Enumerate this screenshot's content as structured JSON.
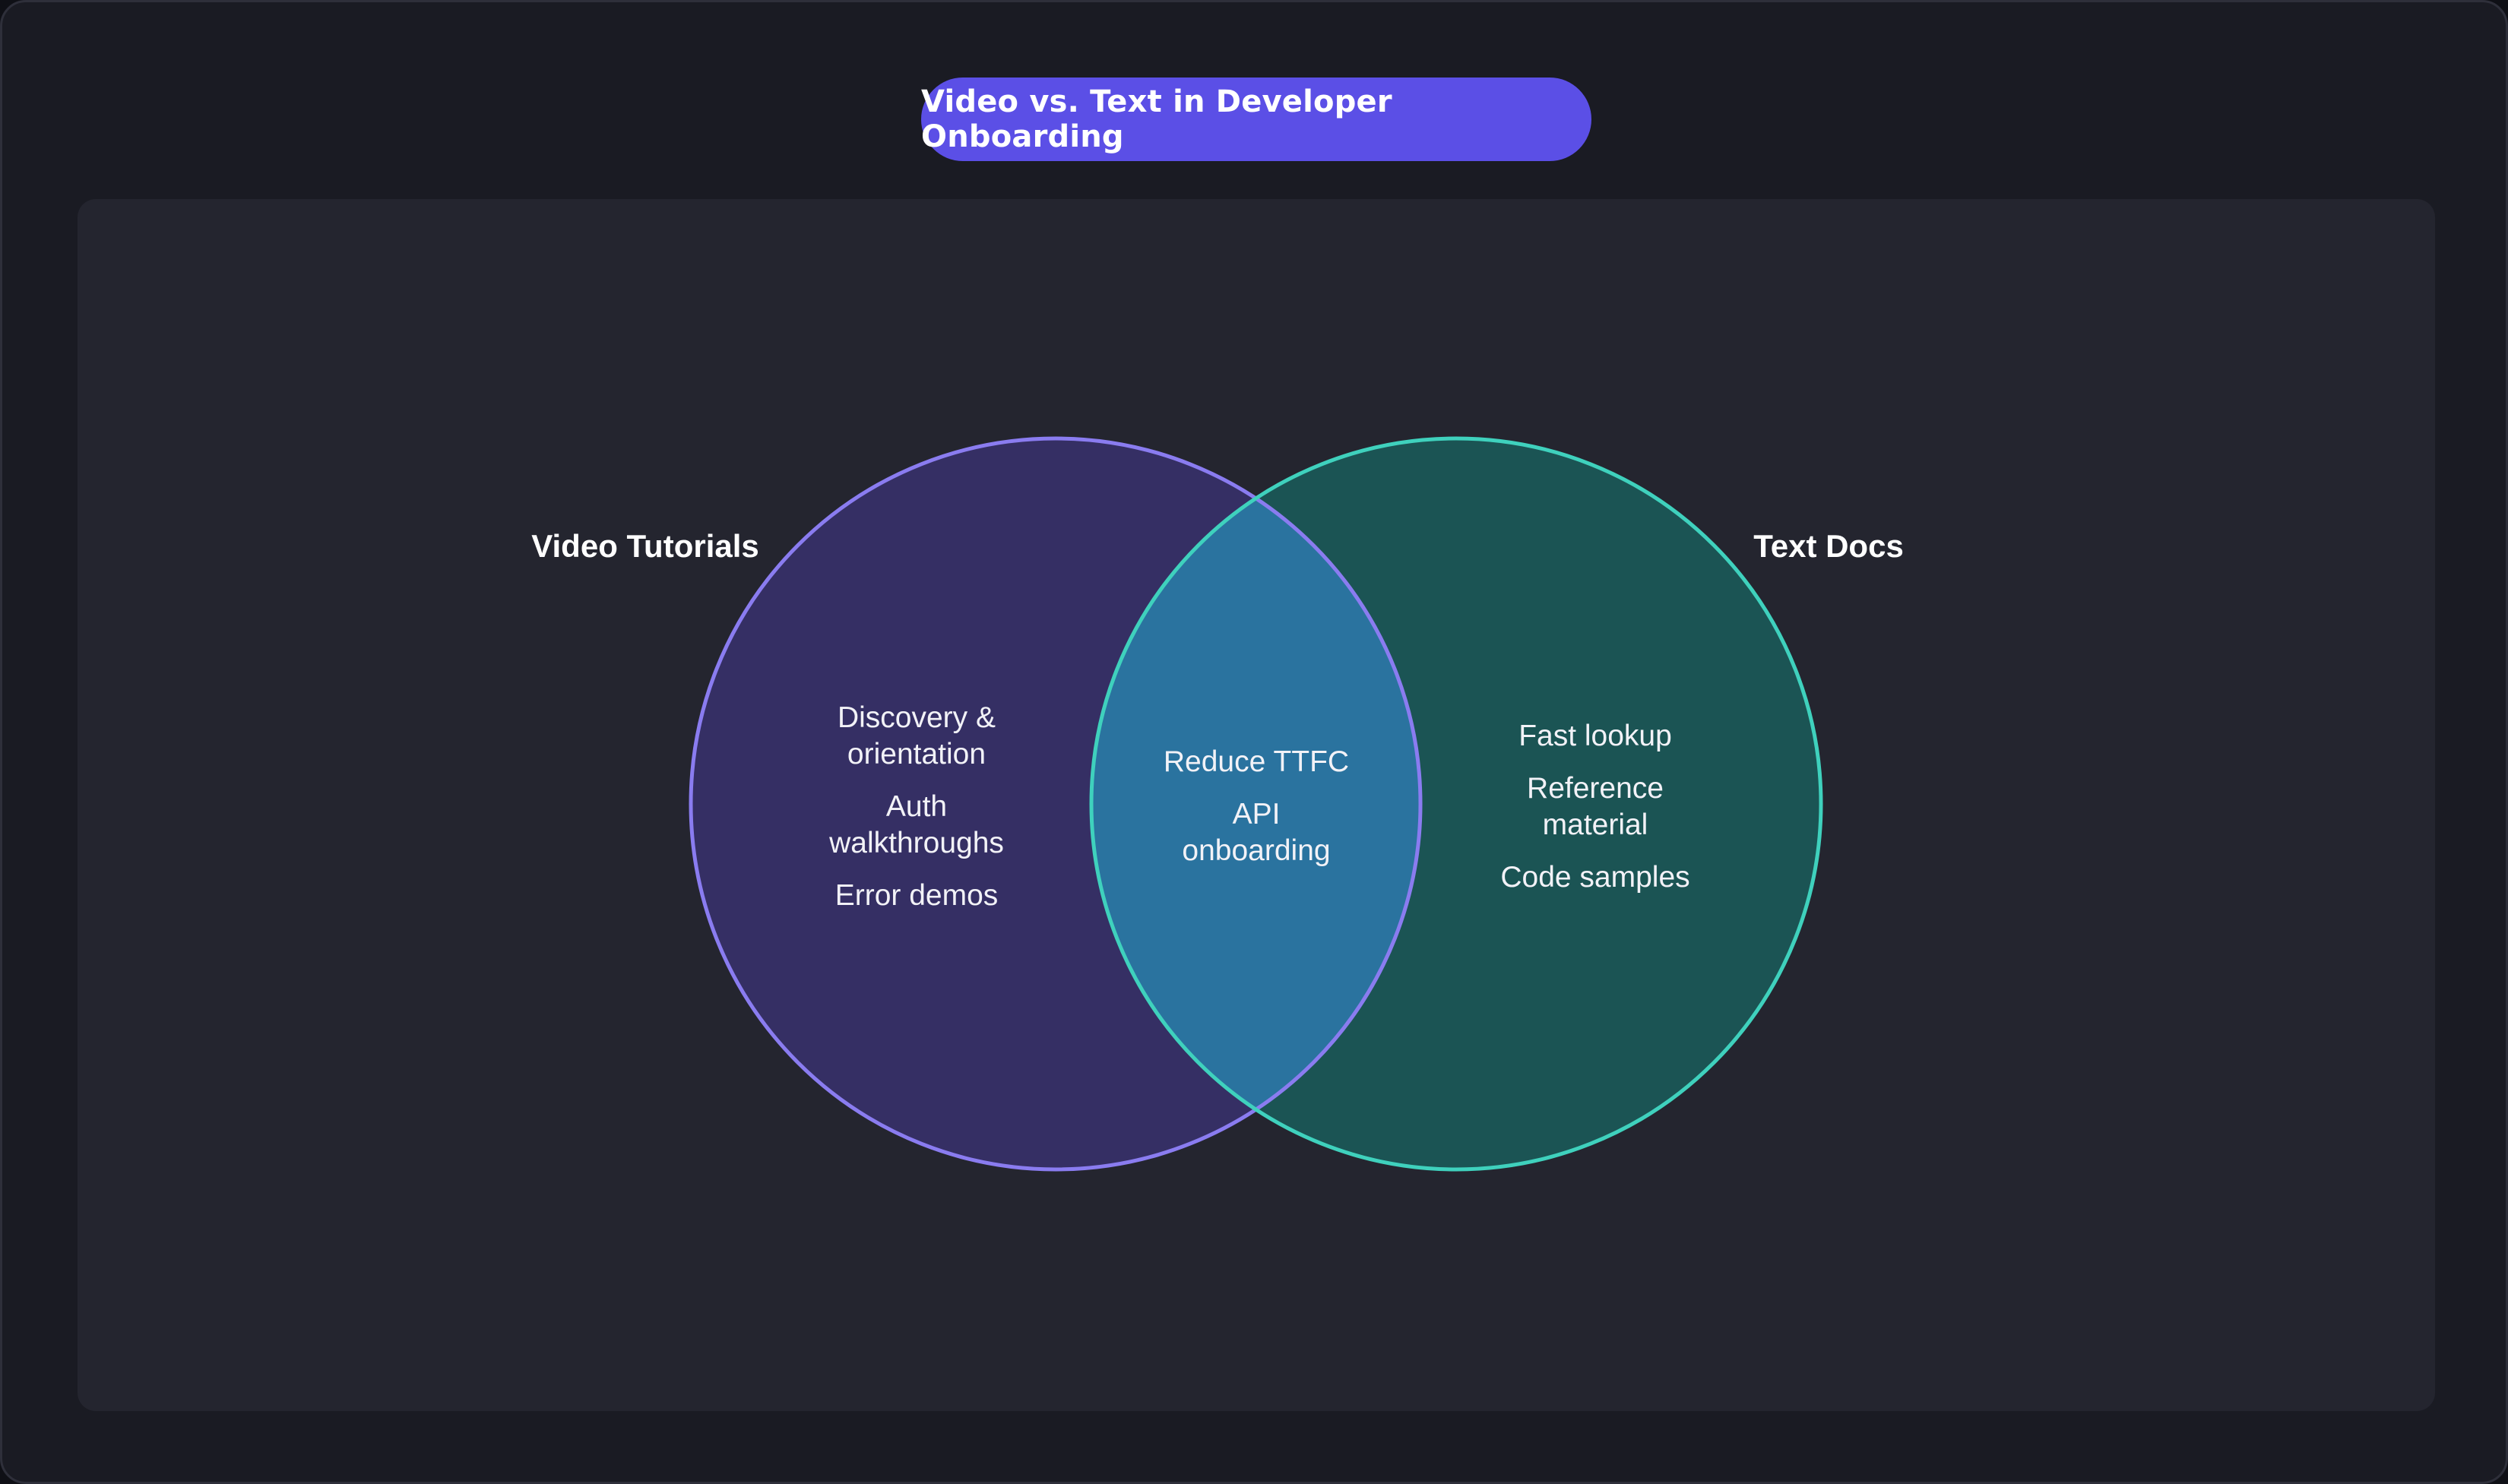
{
  "title": "Video vs. Text in Developer Onboarding",
  "colors": {
    "background": "#1a1b23",
    "panel": "#24252f",
    "title_pill": "#5b4fe6",
    "left_fill": "#352f64",
    "left_stroke": "#8a7cf0",
    "right_fill": "#1b5454",
    "right_stroke": "#3fd1bd",
    "overlap_fill": "#2a739f"
  },
  "sets": {
    "left": {
      "label": "Video Tutorials",
      "items": [
        [
          "Discovery &",
          "orientation"
        ],
        [
          "Auth",
          "walkthroughs"
        ],
        [
          "Error demos"
        ]
      ]
    },
    "right": {
      "label": "Text Docs",
      "items": [
        [
          "Fast lookup"
        ],
        [
          "Reference",
          "material"
        ],
        [
          "Code samples"
        ]
      ]
    },
    "overlap": {
      "items": [
        [
          "Reduce TTFC"
        ],
        [
          "API",
          "onboarding"
        ]
      ]
    }
  }
}
